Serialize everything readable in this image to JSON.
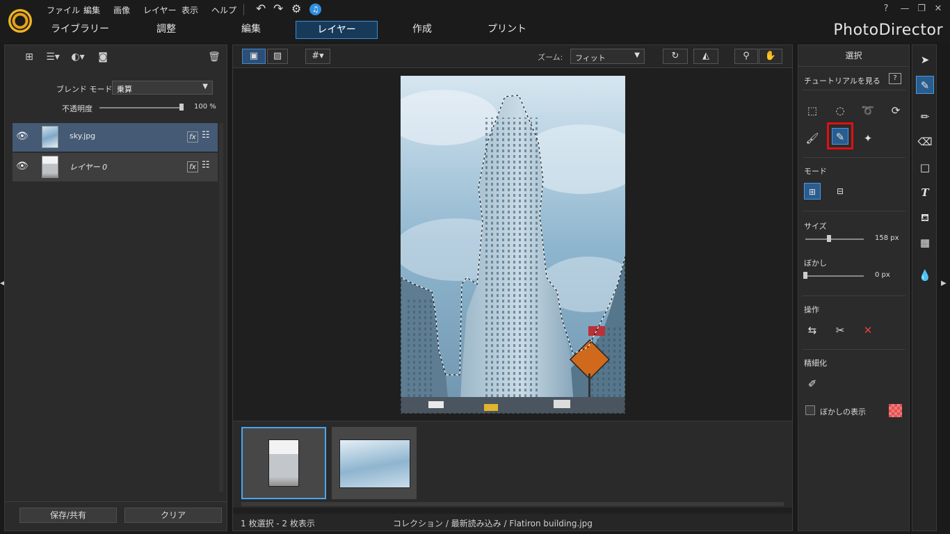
{
  "app": {
    "brand": "PhotoDirector"
  },
  "menu": [
    "ファイル",
    "編集",
    "画像",
    "レイヤー",
    "表示",
    "ヘルプ"
  ],
  "window_controls": {
    "help": "?",
    "minimize": "—",
    "restore": "❐",
    "close": "✕"
  },
  "tabs": [
    "ライブラリー",
    "調整",
    "編集",
    "レイヤー",
    "作成",
    "プリント"
  ],
  "active_tab": "レイヤー",
  "layers_panel": {
    "blend_mode_label": "ブレンド モード:",
    "blend_mode_value": "乗算",
    "opacity_label": "不透明度",
    "opacity_value": "100 %",
    "opacity_fraction": 1.0,
    "layers": [
      {
        "name": "sky.jpg",
        "selected": true,
        "fx": "fx"
      },
      {
        "name": "レイヤー 0",
        "selected": false,
        "fx": "fx"
      }
    ],
    "save_share_label": "保存/共有",
    "clear_label": "クリア"
  },
  "viewer": {
    "zoom_label": "ズーム:",
    "zoom_value": "フィット",
    "status_left": "1 枚選択 - 2 枚表示",
    "status_path": "コレクション / 最新読み込み / Flatiron building.jpg"
  },
  "selection_panel": {
    "title": "選択",
    "tutorial_label": "チュートリアルを見る",
    "mode_label": "モード",
    "size_label": "サイズ",
    "size_value": "158 px",
    "size_fraction": 0.4,
    "feather_label": "ぼかし",
    "feather_value": "0 px",
    "feather_fraction": 0.0,
    "operation_label": "操作",
    "refine_label": "精細化",
    "show_feather_label": "ぼかしの表示",
    "highlight_color": "#e30f0f",
    "accent_color": "#3b8fd6"
  }
}
